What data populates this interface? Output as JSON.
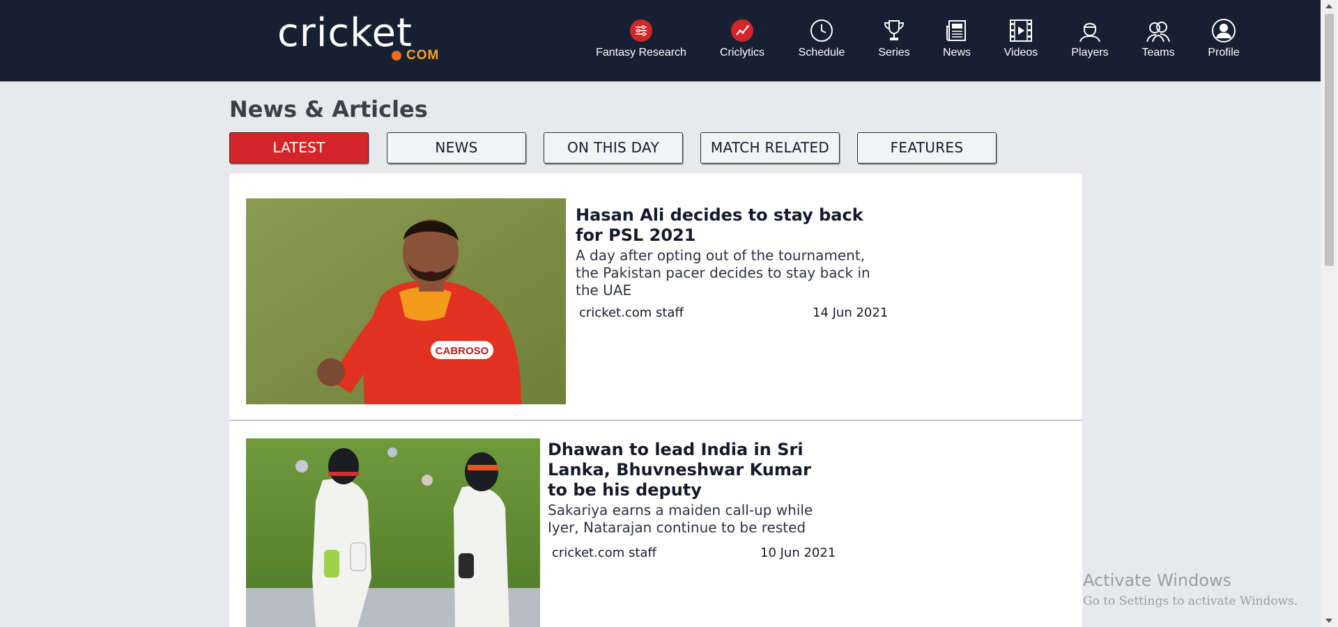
{
  "header": {
    "logo": {
      "word": "cricket",
      "domain": "COM"
    },
    "nav": [
      {
        "label": "Fantasy Research",
        "icon": "sliders-icon"
      },
      {
        "label": "Criclytics",
        "icon": "trend-icon"
      },
      {
        "label": "Schedule",
        "icon": "clock-icon"
      },
      {
        "label": "Series",
        "icon": "trophy-icon"
      },
      {
        "label": "News",
        "icon": "newspaper-icon"
      },
      {
        "label": "Videos",
        "icon": "film-icon"
      },
      {
        "label": "Players",
        "icon": "player-icon"
      },
      {
        "label": "Teams",
        "icon": "team-icon"
      },
      {
        "label": "Profile",
        "icon": "user-circle-icon"
      }
    ]
  },
  "page": {
    "title": "News & Articles",
    "tabs": [
      {
        "label": "LATEST",
        "active": true
      },
      {
        "label": "NEWS",
        "active": false
      },
      {
        "label": "ON THIS DAY",
        "active": false
      },
      {
        "label": "MATCH RELATED",
        "active": false
      },
      {
        "label": "FEATURES",
        "active": false
      }
    ]
  },
  "articles": [
    {
      "title": "Hasan Ali decides to stay back for PSL 2021",
      "description": "A day after opting out of the tournament, the Pakistan pacer decides to stay back in the UAE",
      "author": "cricket.com staff",
      "date": "14 Jun 2021"
    },
    {
      "title": "Dhawan to lead India in Sri Lanka, Bhuvneshwar Kumar to be his deputy",
      "description": "Sakariya earns a maiden call-up while Iyer, Natarajan continue to be rested",
      "author": "cricket.com staff",
      "date": "10 Jun 2021"
    }
  ],
  "watermark": {
    "title": "Activate Windows",
    "subtitle": "Go to Settings to activate Windows."
  },
  "colors": {
    "header_bg": "#172032",
    "accent_red": "#d4262a",
    "page_bg": "#e8e9ed",
    "logo_orange": "#f26b1d",
    "logo_gold": "#f6a621"
  }
}
